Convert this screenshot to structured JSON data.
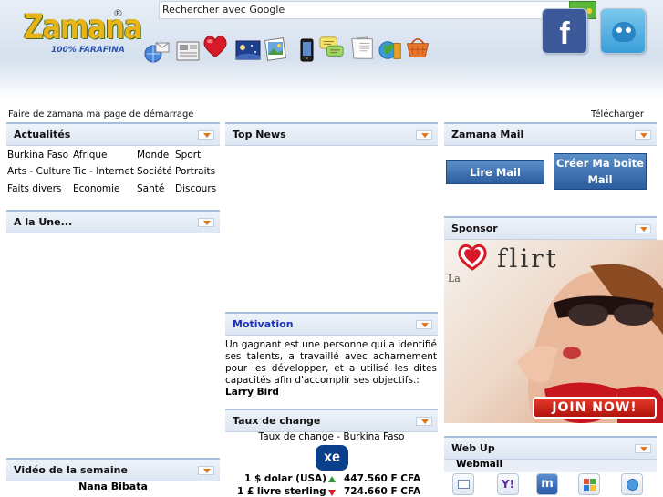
{
  "header": {
    "logo_text": "Zamana",
    "logo_reg": "®",
    "logo_tagline": "100% FARAFINA",
    "search_placeholder": "Rechercher avec Google",
    "search_button_label": "Rechercher",
    "facebook_letter": "f",
    "quick_icons": [
      "globe-mail-icon",
      "newspaper-icon",
      "heart-icon",
      "night-sky-icon",
      "photos-icon",
      "phone-icon",
      "chat-bubbles-icon",
      "documents-icon",
      "world-tools-icon",
      "shopping-basket-icon"
    ]
  },
  "toolbar": {
    "homepage_link": "Faire de zamana ma page de démarrage",
    "download_link": "Télécharger"
  },
  "actualites": {
    "title": "Actualités",
    "links": [
      "Burkina Faso",
      "Afrique",
      "Monde",
      "Sport",
      "Arts - Culture",
      "Tic - Internet",
      "Société",
      "Portraits",
      "Faits divers",
      "Economie",
      "Santé",
      "Discours"
    ]
  },
  "a_la_une": {
    "title": "A la Une..."
  },
  "video": {
    "title": "Vidéo de la semaine",
    "subtitle": "Nana Bibata"
  },
  "top_news": {
    "title": "Top News"
  },
  "motivation": {
    "title": "Motivation",
    "quote": "Un gagnant est une personne qui a identifié ses talents, a travaillé avec acharnement pour les développer, et a utilisé les dites capacités afin d'accomplir ses objectifs.:",
    "author": "Larry Bird"
  },
  "taux": {
    "title": "Taux de change",
    "subtitle": "Taux de change - Burkina Faso",
    "xe_label": "xe",
    "rows": [
      {
        "label": "1 $ dolar (USA)",
        "value": "447.560 F CFA",
        "trend": "up"
      },
      {
        "label": "1 £ livre sterling",
        "value": "724.660 F CFA",
        "trend": "down"
      }
    ]
  },
  "zamana_mail": {
    "title": "Zamana Mail",
    "read_label": "Lire Mail",
    "create_label_line1": "Créer Ma boîte",
    "create_label_line2": "Mail"
  },
  "sponsor": {
    "title": "Sponsor",
    "ad_brand": "flirt",
    "ad_prefix": "La",
    "ad_button": "JOIN NOW!"
  },
  "webup": {
    "title": "Web Up",
    "webmail_label": "Webmail",
    "webmail_icons": [
      "mail-icon",
      "yahoo-icon",
      "msn-icon",
      "windows-icon",
      "webmail-globe-icon"
    ]
  },
  "colors": {
    "accent_blue": "#1a2fbf",
    "panel_header": "#dde6f2",
    "mail_button": "#2c5d9e",
    "dropdown_arrow": "#e07818"
  }
}
